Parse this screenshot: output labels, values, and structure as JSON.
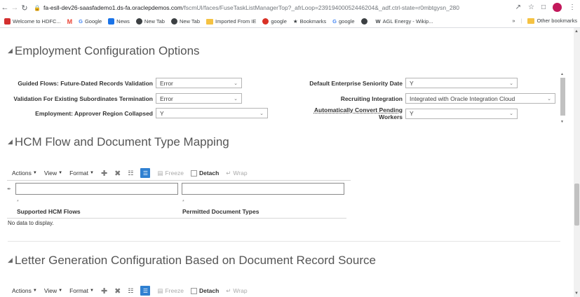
{
  "browser": {
    "url_host": "fa-esll-dev26-saasfademo1.ds-fa.oraclepdemos.com",
    "url_path": "/fscmUI/faces/FuseTaskListManagerTop?_afrLoop=23919400052446204&_adf.ctrl-state=r0mbtgysn_280",
    "bookmarks": [
      {
        "label": "Welcome to HDFC...",
        "color": "#d32f2f"
      },
      {
        "label": "",
        "color": "#ea4335",
        "glyph": "M"
      },
      {
        "label": "Google",
        "color": "#4285f4",
        "glyph": "G"
      },
      {
        "label": "News",
        "color": "#1a73e8"
      },
      {
        "label": "New Tab",
        "color": "#3c4043"
      },
      {
        "label": "New Tab",
        "color": "#3c4043"
      },
      {
        "label": "Imported From IE",
        "color": "#f5c242"
      },
      {
        "label": "google",
        "color": "#d93025"
      },
      {
        "label": "Bookmarks",
        "color": "#3c4043",
        "glyph": "★"
      },
      {
        "label": "google",
        "color": "#4285f4",
        "glyph": "G"
      },
      {
        "label": "",
        "color": "#3c4043"
      },
      {
        "label": "AGL Energy - Wikip...",
        "color": "#3c4043",
        "glyph": "W"
      }
    ],
    "bookmarks_more": "»",
    "other_bookmarks": "Other bookmarks"
  },
  "sections": {
    "employment": {
      "title": "Employment Configuration Options",
      "fields_left": [
        {
          "label": "Guided Flows: Future-Dated Records Validation",
          "value": "Error"
        },
        {
          "label": "Validation For Existing Subordinates Termination",
          "value": "Error"
        },
        {
          "label": "Employment: Approver Region Collapsed",
          "value": "Y"
        }
      ],
      "fields_right": [
        {
          "label": "Default Enterprise Seniority Date",
          "value": "Y"
        },
        {
          "label": "Recruiting Integration",
          "value": "Integrated with Oracle Integration Cloud"
        },
        {
          "label_line1": "Automatically Convert Pending",
          "label_line2": "Workers",
          "value": "Y"
        }
      ]
    },
    "hcm": {
      "title": "HCM Flow and Document Type Mapping",
      "toolbar": {
        "actions": "Actions",
        "view": "View",
        "format": "Format",
        "freeze": "Freeze",
        "detach": "Detach",
        "wrap": "Wrap"
      },
      "columns": [
        "Supported HCM Flows",
        "Permitted Document Types"
      ],
      "required_marker": "*",
      "empty_text": "No data to display."
    },
    "letter": {
      "title": "Letter Generation Configuration Based on Document Record Source",
      "toolbar": {
        "actions": "Actions",
        "view": "View",
        "format": "Format",
        "freeze": "Freeze",
        "detach": "Detach",
        "wrap": "Wrap"
      }
    }
  }
}
